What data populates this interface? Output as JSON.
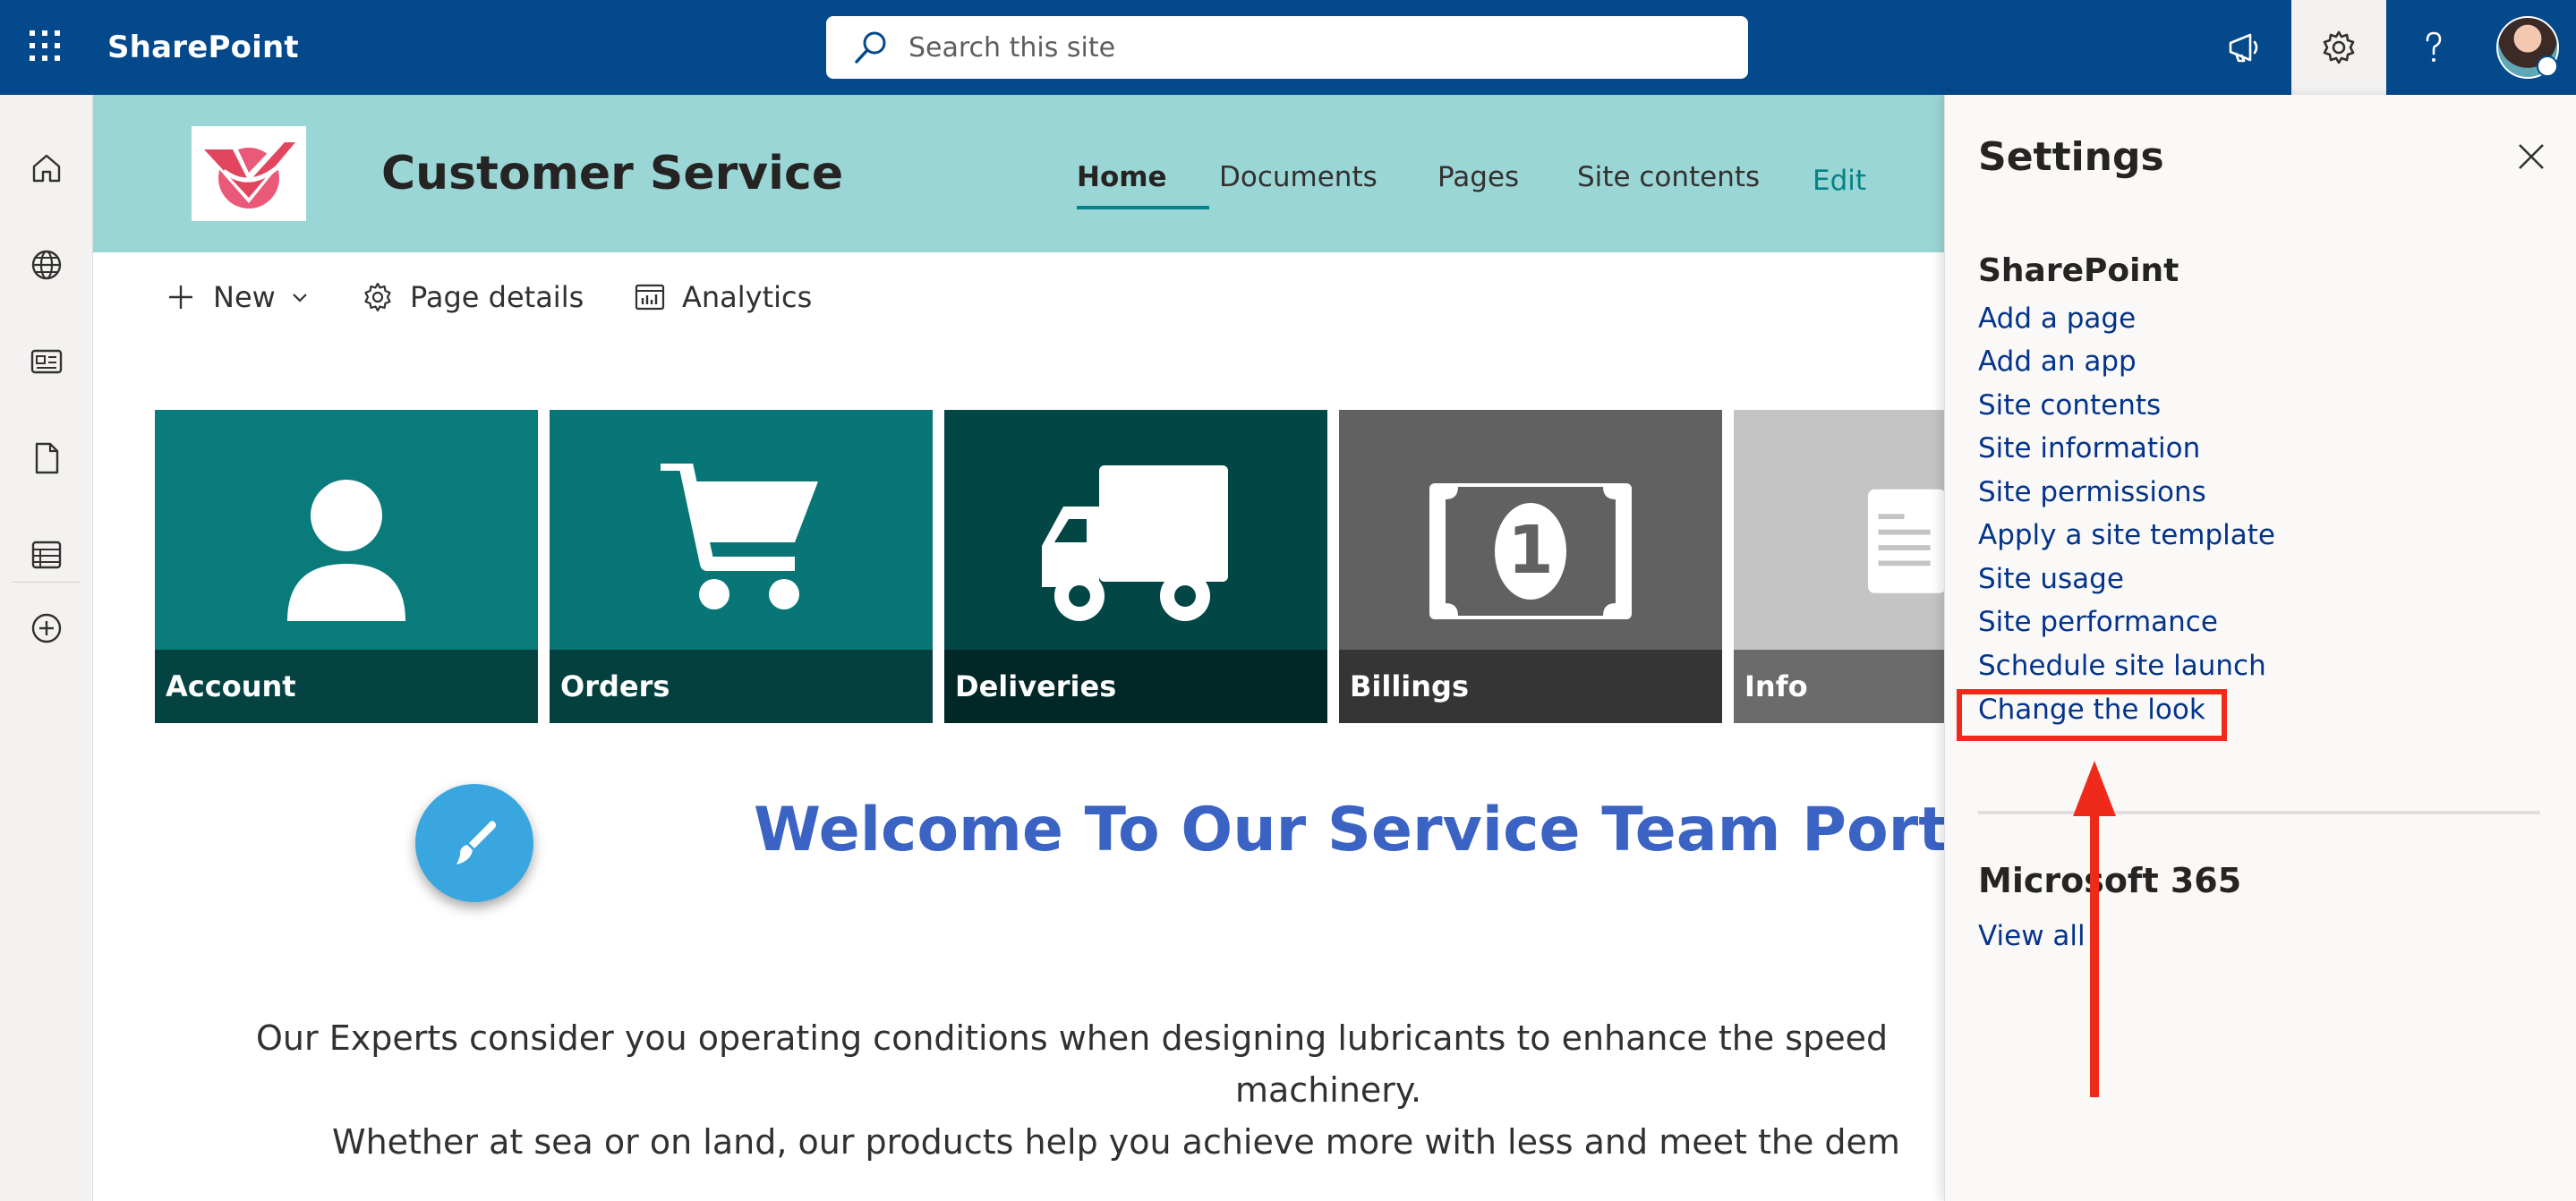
{
  "suite_bar": {
    "app_name": "SharePoint",
    "search_placeholder": "Search this site"
  },
  "site": {
    "title": "Customer Service",
    "nav": [
      {
        "label": "Home",
        "active": true
      },
      {
        "label": "Documents"
      },
      {
        "label": "Pages"
      },
      {
        "label": "Site contents"
      },
      {
        "label": "Edit"
      }
    ]
  },
  "command_bar": {
    "new_label": "New",
    "page_details_label": "Page details",
    "analytics_label": "Analytics"
  },
  "tiles": [
    {
      "label": "Account",
      "color": "#0a7b7b",
      "icon": "person-icon"
    },
    {
      "label": "Orders",
      "color": "#087676",
      "icon": "cart-icon"
    },
    {
      "label": "Deliveries",
      "color": "#024746",
      "icon": "truck-icon"
    },
    {
      "label": "Billings",
      "color": "#616161",
      "icon": "banknote-icon"
    },
    {
      "label": "Info",
      "color": "#c4c4c4",
      "icon": "document-icon"
    }
  ],
  "welcome": {
    "heading": "Welcome To Our Service Team Portal",
    "line1": "Our Experts consider you operating conditions when designing lubricants to enhance the speed",
    "line2": "machinery.",
    "line3": "Whether at sea or on land, our products help you achieve more with less and meet the dem"
  },
  "settings_panel": {
    "title": "Settings",
    "sharepoint_section": "SharePoint",
    "links": [
      "Add a page",
      "Add an app",
      "Site contents",
      "Site information",
      "Site permissions",
      "Apply a site template",
      "Site usage",
      "Site performance",
      "Schedule site launch",
      "Change the look"
    ],
    "m365_section": "Microsoft 365",
    "view_all": "View all"
  },
  "colors": {
    "suite_bar": "#03498c",
    "site_header": "#9bd6d6",
    "accent": "#038387",
    "link": "#03338a",
    "highlight": "#f02a1b"
  }
}
